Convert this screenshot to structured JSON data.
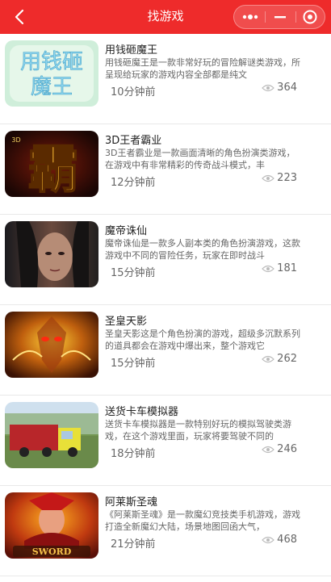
{
  "header": {
    "title": "找游戏",
    "bg_color": "#ee2b2b",
    "icons": [
      "back-arrow-icon",
      "more-dots-icon",
      "minimize-icon",
      "close-circle-icon"
    ]
  },
  "games": [
    {
      "title": "用钱砸魔王",
      "desc": "用钱砸魔王是一款非常好玩的冒险解谜类游戏，所呈现给玩家的游戏内容全部都是纯文",
      "time": "10分钟前",
      "views": "364",
      "thumb_text_1": "用钱砸",
      "thumb_text_2": "魔王"
    },
    {
      "title": "3D王者霸业",
      "desc": "3D王者霸业是一款画面清晰的角色扮演类游戏，在游戏中有非常精彩的传奇战斗模式，丰",
      "time": "12分钟前",
      "views": "223",
      "thumb_text_1": "霸",
      "thumb_text_2": "3D"
    },
    {
      "title": "魔帝诛仙",
      "desc": "魔帝诛仙是一款多人副本类的角色扮演游戏，这款游戏中不同的冒险任务，玩家在即时战斗",
      "time": "15分钟前",
      "views": "181"
    },
    {
      "title": "圣皇天影",
      "desc": "圣皇天影这是个角色扮演的游戏，超级多沉默系列的道具都会在游戏中爆出来，整个游戏它",
      "time": "15分钟前",
      "views": "262"
    },
    {
      "title": "送货卡车模拟器",
      "desc": "送货卡车模拟器是一款特别好玩的模拟驾驶类游戏，在这个游戏里面，玩家将要驾驶不同的",
      "time": "18分钟前",
      "views": "246"
    },
    {
      "title": "阿莱斯圣魂",
      "desc": "《阿莱斯圣魂》是一款魔幻竞技类手机游戏，游戏打造全新魔幻大陆，场景地图回函大气，",
      "time": "21分钟前",
      "views": "468",
      "thumb_text_1": "SWORD"
    }
  ]
}
